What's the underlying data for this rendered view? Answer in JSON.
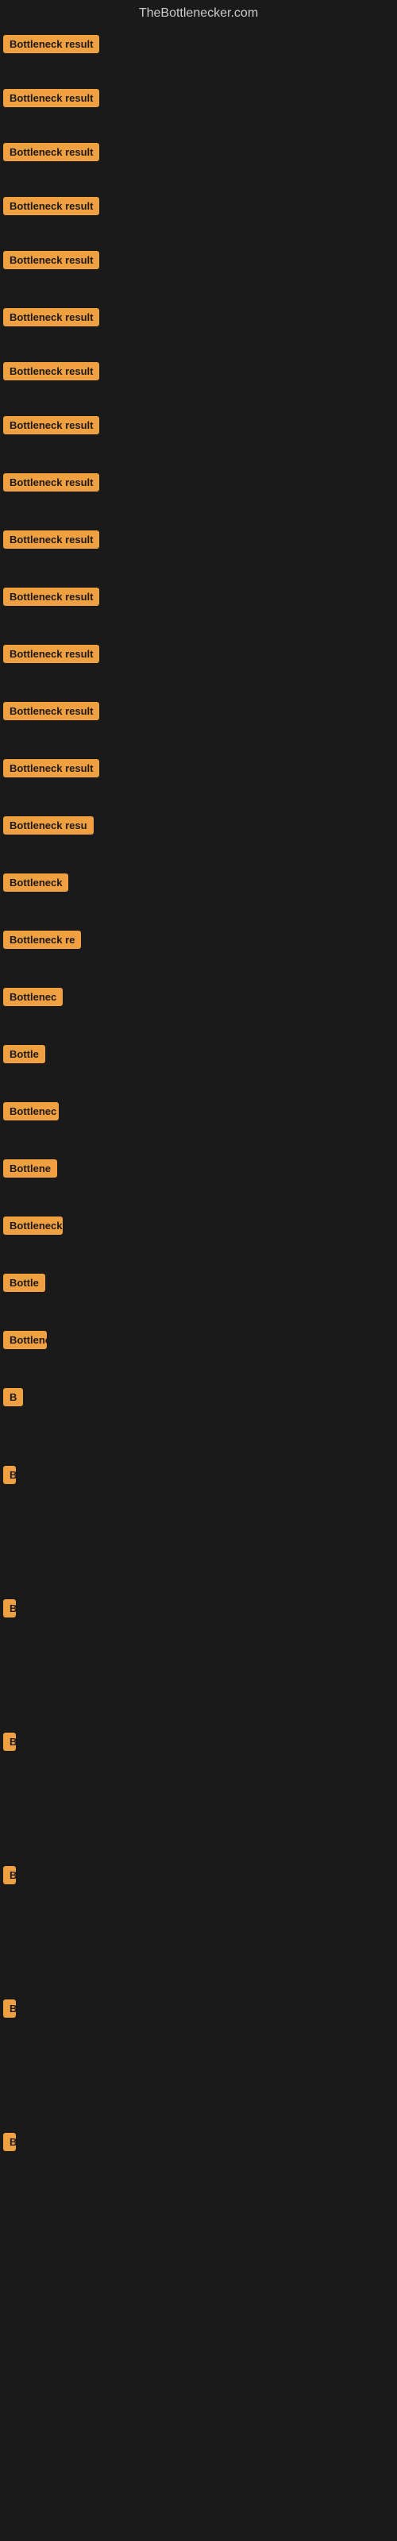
{
  "site": {
    "title": "TheBottlenecker.com"
  },
  "items": [
    {
      "id": 1,
      "label": "Bottleneck result",
      "class": "item-1"
    },
    {
      "id": 2,
      "label": "Bottleneck result",
      "class": "item-2"
    },
    {
      "id": 3,
      "label": "Bottleneck result",
      "class": "item-3"
    },
    {
      "id": 4,
      "label": "Bottleneck result",
      "class": "item-4"
    },
    {
      "id": 5,
      "label": "Bottleneck result",
      "class": "item-5"
    },
    {
      "id": 6,
      "label": "Bottleneck result",
      "class": "item-6"
    },
    {
      "id": 7,
      "label": "Bottleneck result",
      "class": "item-7"
    },
    {
      "id": 8,
      "label": "Bottleneck result",
      "class": "item-8"
    },
    {
      "id": 9,
      "label": "Bottleneck result",
      "class": "item-9"
    },
    {
      "id": 10,
      "label": "Bottleneck result",
      "class": "item-10"
    },
    {
      "id": 11,
      "label": "Bottleneck result",
      "class": "item-11"
    },
    {
      "id": 12,
      "label": "Bottleneck result",
      "class": "item-12"
    },
    {
      "id": 13,
      "label": "Bottleneck result",
      "class": "item-13"
    },
    {
      "id": 14,
      "label": "Bottleneck result",
      "class": "item-14"
    },
    {
      "id": 15,
      "label": "Bottleneck resu",
      "class": "item-15"
    },
    {
      "id": 16,
      "label": "Bottleneck",
      "class": "item-16"
    },
    {
      "id": 17,
      "label": "Bottleneck re",
      "class": "item-17"
    },
    {
      "id": 18,
      "label": "Bottlenec",
      "class": "item-18"
    },
    {
      "id": 19,
      "label": "Bottle",
      "class": "item-19"
    },
    {
      "id": 20,
      "label": "Bottlenec",
      "class": "item-20"
    },
    {
      "id": 21,
      "label": "Bottlene",
      "class": "item-21"
    },
    {
      "id": 22,
      "label": "Bottleneck",
      "class": "item-22"
    },
    {
      "id": 23,
      "label": "Bottle",
      "class": "item-23"
    },
    {
      "id": 24,
      "label": "Bottlenec",
      "class": "item-24"
    },
    {
      "id": 25,
      "label": "B",
      "class": "item-25"
    },
    {
      "id": 26,
      "label": "B",
      "class": "item-26"
    },
    {
      "id": 27,
      "label": "B",
      "class": "item-27"
    },
    {
      "id": 28,
      "label": "B",
      "class": "item-28"
    },
    {
      "id": 29,
      "label": "B",
      "class": "item-29"
    },
    {
      "id": 30,
      "label": "B",
      "class": "item-30"
    },
    {
      "id": 31,
      "label": "B",
      "class": "item-31"
    }
  ]
}
